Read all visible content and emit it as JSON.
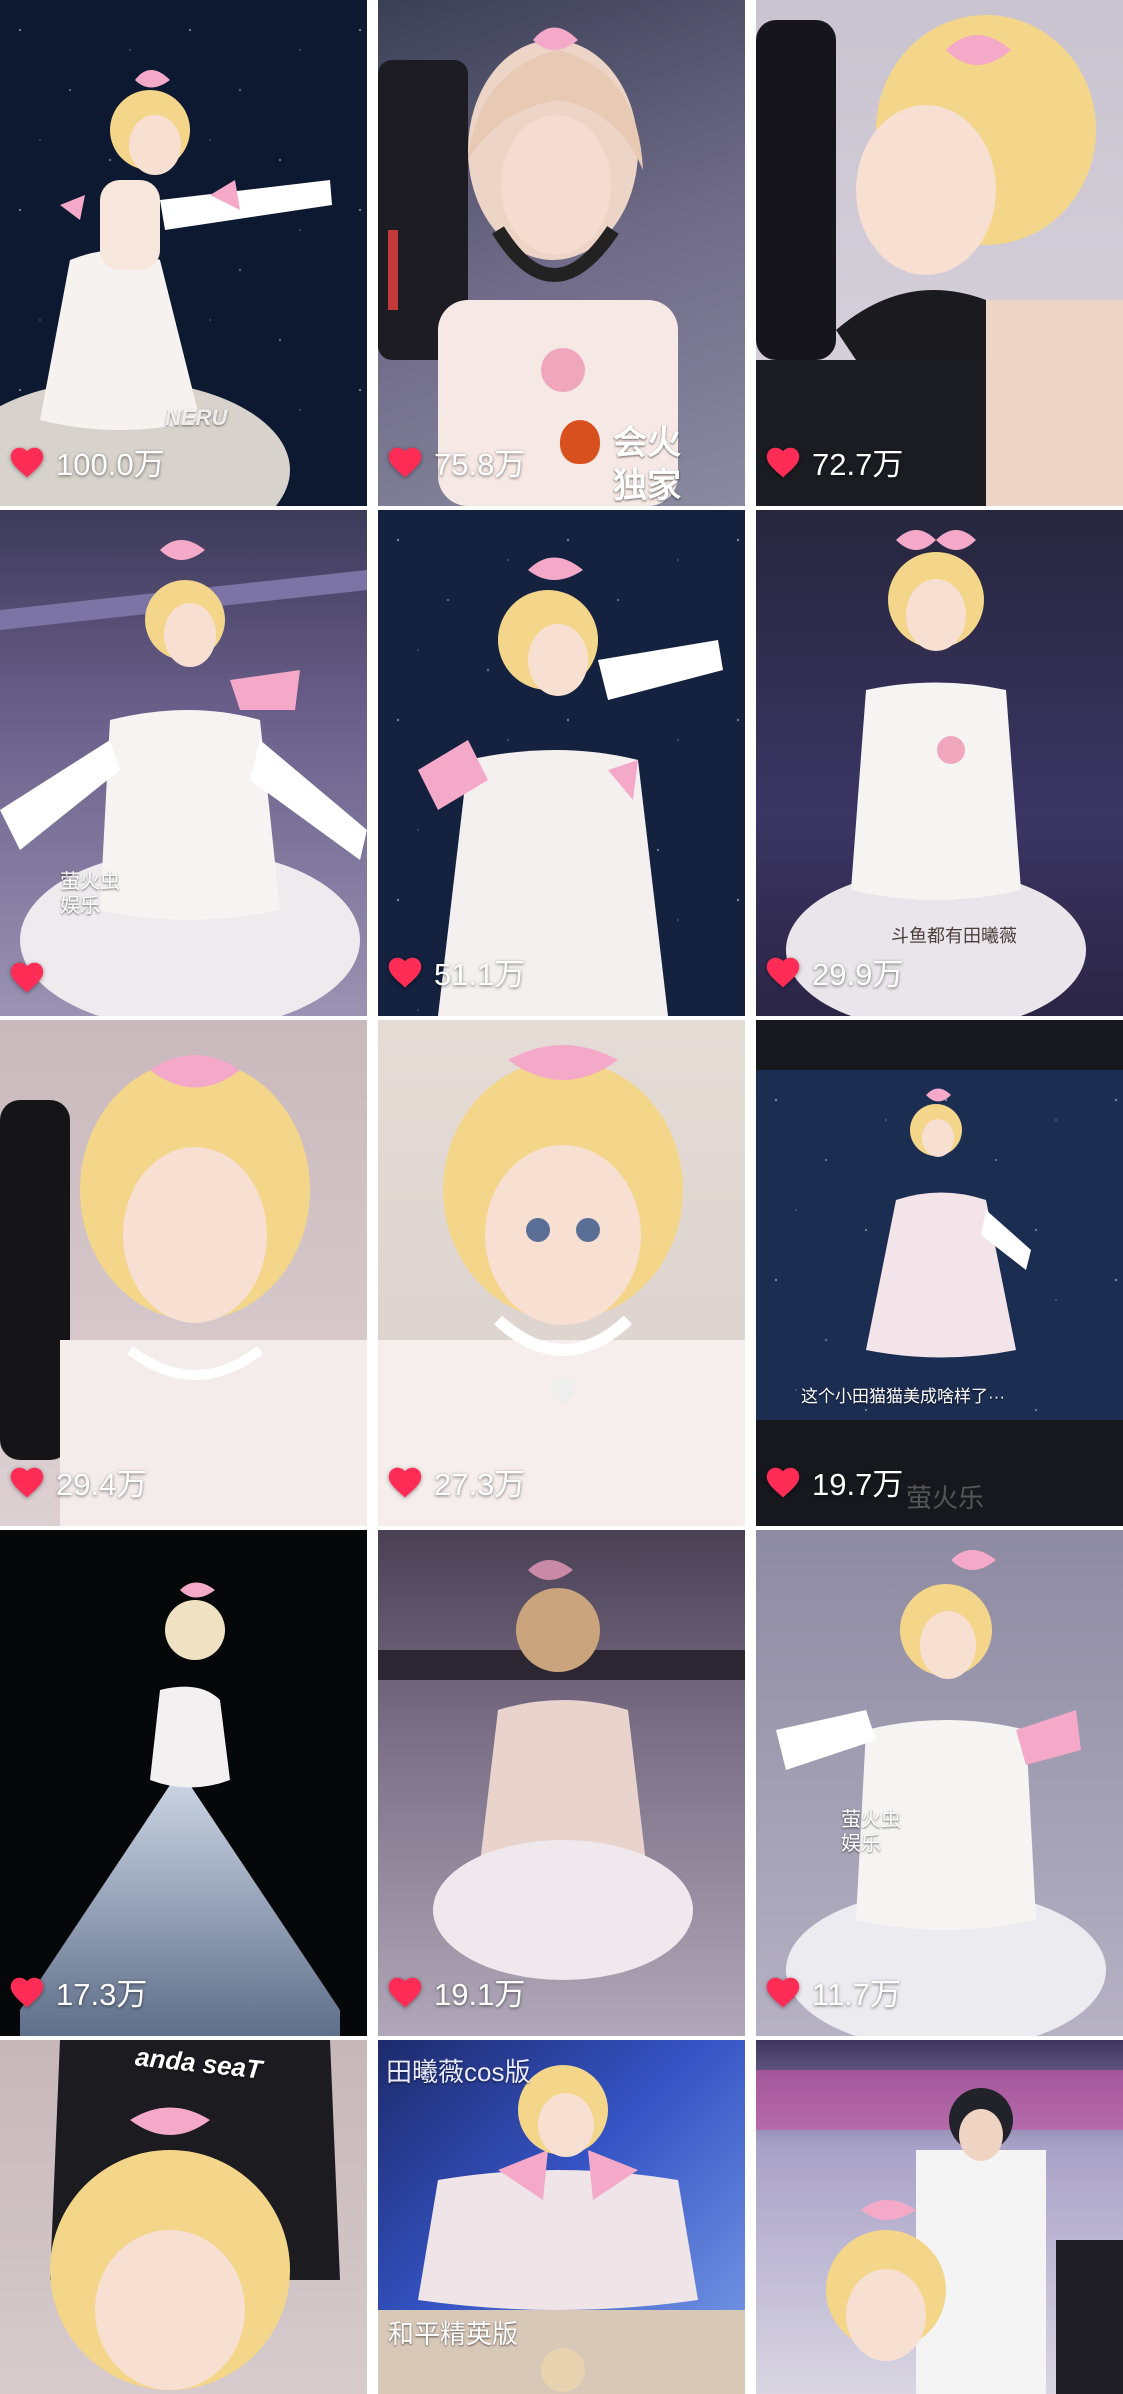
{
  "icons": {
    "like": "heart-icon"
  },
  "colors": {
    "heart": "#ff2d55",
    "bow": "#f4a9c8",
    "hair": "#f3d68a"
  },
  "tiles": [
    {
      "likes": "100.0万",
      "watermark": "NERU"
    },
    {
      "likes": "75.8万",
      "badge_line1": "会火",
      "badge_line2": "独家"
    },
    {
      "likes": "72.7万"
    },
    {
      "likes": "",
      "watermark": "萤火虫\n娱乐"
    },
    {
      "likes": "51.1万"
    },
    {
      "likes": "29.9万",
      "caption": "斗鱼都有田曦薇"
    },
    {
      "likes": "29.4万"
    },
    {
      "likes": "27.3万"
    },
    {
      "likes": "19.7万",
      "subtitle": "这个小田猫猫美成啥样了···",
      "bottom_text": "萤火乐"
    },
    {
      "likes": "17.3万"
    },
    {
      "likes": "19.1万"
    },
    {
      "likes": "11.7万",
      "watermark": "萤火虫\n娱乐"
    },
    {
      "chair_text": "anda seaT"
    },
    {
      "top_caption": "田曦薇cos版",
      "bottom_caption": "和平精英版"
    },
    {}
  ]
}
